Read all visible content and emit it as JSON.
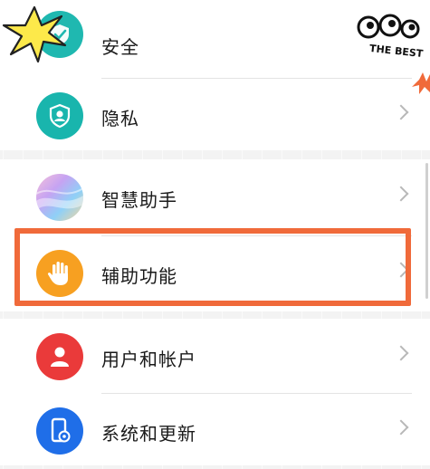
{
  "settings": {
    "items": [
      {
        "label": "安全",
        "icon": "shield-check-icon",
        "color": "#1fb8b0"
      },
      {
        "label": "隐私",
        "icon": "privacy-user-shield-icon",
        "color": "#19b5ad"
      },
      {
        "label": "智慧助手",
        "icon": "smart-assistant-icon",
        "color": "#b58fe8"
      },
      {
        "label": "辅助功能",
        "icon": "hand-icon",
        "color": "#f7a021"
      },
      {
        "label": "用户和帐户",
        "icon": "user-icon",
        "color": "#ea3a3a"
      },
      {
        "label": "系统和更新",
        "icon": "phone-settings-icon",
        "color": "#1f6ee8"
      }
    ]
  },
  "stickers": {
    "best_text": "THE BEST"
  },
  "colors": {
    "highlight": "#f06a3a",
    "background": "#f3f3f3"
  }
}
